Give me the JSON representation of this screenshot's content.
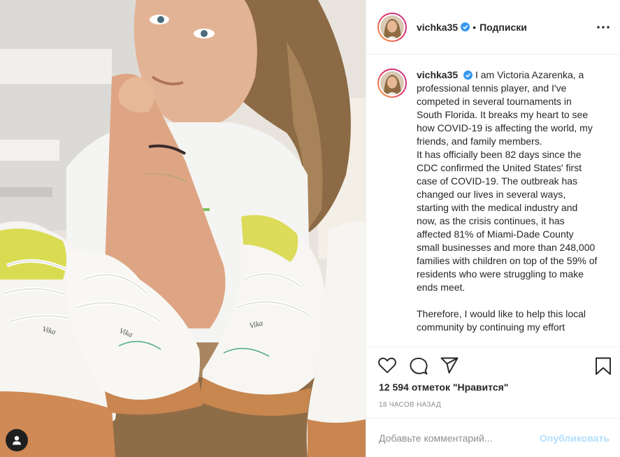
{
  "post": {
    "username": "vichka35",
    "follow_status": "Подписки",
    "caption": [
      "I am Victoria Azarenka, a professional tennis player, and I've competed in several tournaments in South Florida. It breaks my heart to see how COVID-19 is affecting the world, my friends, and family members.",
      "It has officially been 82 days since the CDC confirmed the United States' first case of COVID-19. The outbreak has changed our lives in several ways, starting with the medical industry and now, as the crisis continues, it has affected 81% of Miami-Dade County small businesses and more than 248,000 families with children on top of the 59% of residents who were struggling to make ends meet.",
      "Therefore, I would like to help this local community by continuing my effort"
    ],
    "likes_text": "12 594 отметок \"Нравится\"",
    "timestamp": "18 ЧАСОВ НАЗАД",
    "comment_placeholder": "Добавьте комментарий...",
    "publish_label": "Опубликовать",
    "shoe_text": "Vika"
  },
  "icons": {
    "verified": "verified-badge-icon",
    "more": "more-options-icon",
    "like": "heart-icon",
    "comment": "comment-icon",
    "share": "share-icon",
    "save": "bookmark-icon",
    "user_tag": "user-tag-icon"
  },
  "colors": {
    "verified_blue": "#3897f0",
    "publish_disabled": "#b2dffc",
    "text_primary": "#262626",
    "text_secondary": "#8e8e8e",
    "border": "#efefef"
  }
}
